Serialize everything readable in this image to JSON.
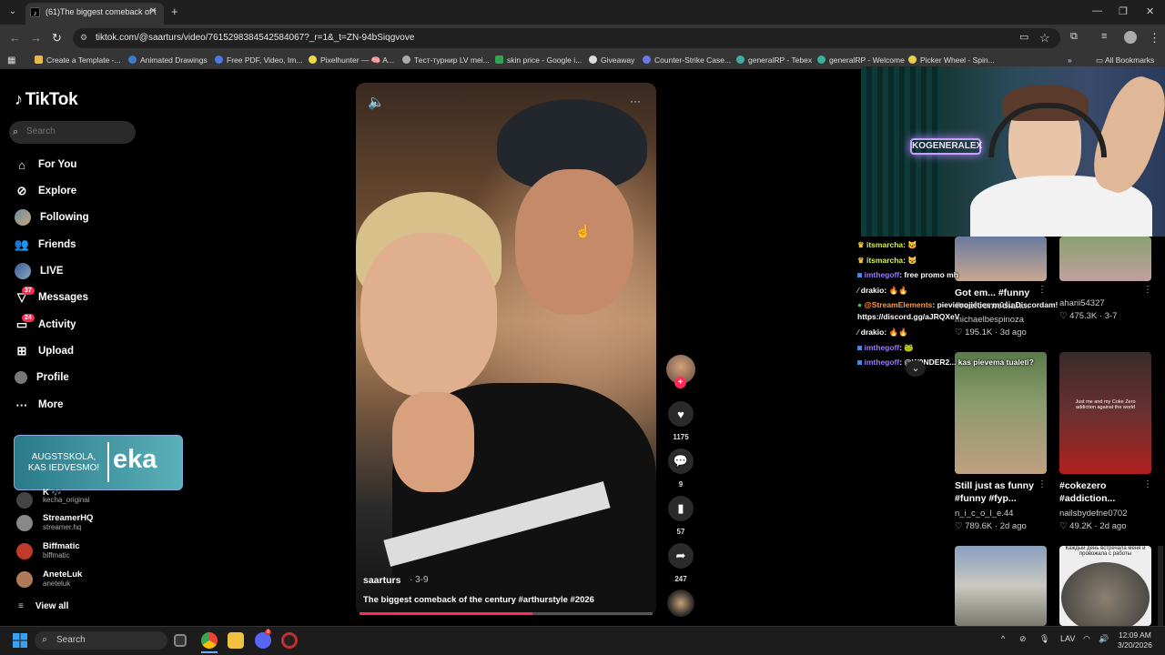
{
  "browser": {
    "tab_title": "(61)The biggest comeback of t",
    "url": "tiktok.com/@saarturs/video/7615298384542584067?_r=1&_t=ZN-94bSiqgvove",
    "bookmarks": [
      "Create a Template -...",
      "Animated Drawings",
      "Free PDF, Video, Im...",
      "Pixelhunter — 🧠 A...",
      "Тест-турнир LV mei...",
      "skin price - Google i...",
      "Giveaway",
      "Counter-Strike Case...",
      "generalRP - Tebex",
      "generalRP - Welcome",
      "Picker Wheel - Spin..."
    ],
    "all_bookmarks": "All Bookmarks"
  },
  "tiktok": {
    "logo": "TikTok",
    "search_placeholder": "Search",
    "nav": [
      {
        "label": "For You",
        "icon": "home-icon"
      },
      {
        "label": "Explore",
        "icon": "compass-icon"
      },
      {
        "label": "Following",
        "icon": "following-avatar-icon"
      },
      {
        "label": "Friends",
        "icon": "friends-icon"
      },
      {
        "label": "LIVE",
        "icon": "live-icon"
      },
      {
        "label": "Messages",
        "icon": "messages-icon",
        "badge": "37"
      },
      {
        "label": "Activity",
        "icon": "activity-icon",
        "badge": "24"
      },
      {
        "label": "Upload",
        "icon": "upload-icon"
      },
      {
        "label": "Profile",
        "icon": "profile-icon"
      },
      {
        "label": "More",
        "icon": "more-icon"
      }
    ],
    "ad": {
      "text": "AUGSTSKOLA, KAS IEDVESMO!",
      "brand": "eka"
    },
    "following_accounts": [
      {
        "name": "K 🎶",
        "handle": "kecha_original"
      },
      {
        "name": "StreamerHQ",
        "handle": "streamer.hq"
      },
      {
        "name": "Biffmatic",
        "handle": "biffmatic"
      },
      {
        "name": "AneteLuk",
        "handle": "aneteluk"
      }
    ],
    "view_all": "View all",
    "video": {
      "author": "saarturs",
      "date": "· 3-9",
      "caption": "The biggest comeback of the century #arthurstyle #2026",
      "progress": 0.59,
      "likes": "1175",
      "comments": "9",
      "saves": "57",
      "shares": "247"
    },
    "suggested": [
      {
        "title": "Got em... #funny",
        "title2": "#reelcomedian...",
        "user": "michaelbespinoza",
        "stats": "♡ 195.1K · 3d ago"
      },
      {
        "title": "",
        "title2": "",
        "user": "aharii54327",
        "stats": "♡ 475.3K · 3-7"
      },
      {
        "title": "Still just as funny",
        "title2": "#funny #fyp...",
        "user": "n_i_c_o_l_e.44",
        "stats": "♡ 789.6K · 2d ago"
      },
      {
        "title": "#cokezero",
        "title2": "#addiction...",
        "user": "nailsbydefne0702",
        "stats": "♡ 49.2K · 2d ago"
      }
    ],
    "thumb_texts": {
      "coke": "Just me and my Coke Zero addiction against the world",
      "cat": "Каждый день встречала меня и провожала с работы"
    }
  },
  "stream": {
    "neon_sign": "KOGENERALEX",
    "chat": [
      {
        "user": "itsmarcha",
        "msg": ": 🐱",
        "color": "#d6f24a"
      },
      {
        "user": "itsmarcha",
        "msg": ": 🐱",
        "color": "#d6f24a"
      },
      {
        "user": "imthegoff",
        "msg": ": free promo mh",
        "color": "#9a7bff"
      },
      {
        "user": "drakio",
        "msg": ": 🔥🔥",
        "color": "#ffffff"
      },
      {
        "user": "@StreamElements",
        "msg": ": pievienojieties mūsu Discordam!",
        "color": "#ff9a3c"
      },
      {
        "user": "",
        "msg": "https://discord.gg/aJRQXeV",
        "color": "#ffffff"
      },
      {
        "user": "drakio",
        "msg": ": 🔥🔥",
        "color": "#ffffff"
      },
      {
        "user": "imthegoff",
        "msg": ": 🐸",
        "color": "#9a7bff"
      },
      {
        "user": "imthegoff",
        "msg": ": @W0NDER2... kas pievemа tualeti?",
        "color": "#9a7bff"
      }
    ]
  },
  "taskbar": {
    "search": "Search",
    "lang": "LAV",
    "time": "12:09 AM",
    "date": "3/20/2026",
    "discord_badge": "8"
  }
}
